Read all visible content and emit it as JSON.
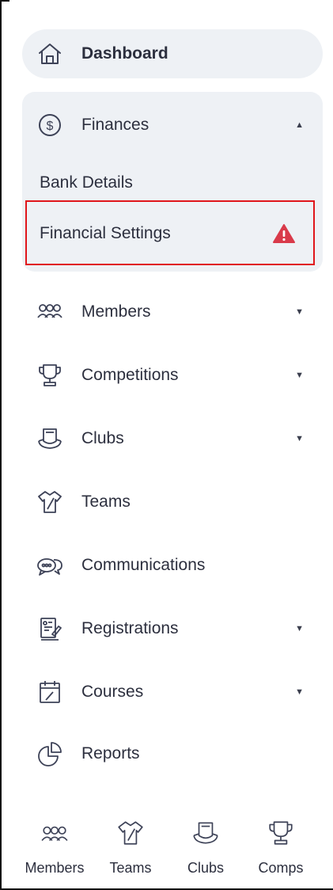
{
  "nav": {
    "dashboard": {
      "label": "Dashboard",
      "icon": "home-icon"
    },
    "finances": {
      "label": "Finances",
      "icon": "dollar-circle-icon",
      "expanded": true,
      "sub_items": [
        {
          "label": "Bank Details"
        },
        {
          "label": "Financial Settings",
          "warning_icon": "warning-triangle-icon",
          "warning_color": "#d93a4a"
        }
      ]
    },
    "members": {
      "label": "Members",
      "icon": "members-icon"
    },
    "competitions": {
      "label": "Competitions",
      "icon": "trophy-icon"
    },
    "clubs": {
      "label": "Clubs",
      "icon": "club-shield-icon"
    },
    "teams": {
      "label": "Teams",
      "icon": "jersey-icon"
    },
    "communications": {
      "label": "Communications",
      "icon": "chat-bubbles-icon"
    },
    "registrations": {
      "label": "Registrations",
      "icon": "clipboard-icon"
    },
    "courses": {
      "label": "Courses",
      "icon": "calendar-icon"
    },
    "reports": {
      "label": "Reports",
      "icon": "pie-chart-icon"
    }
  },
  "bottom_nav": [
    {
      "label": "Members",
      "icon": "members-icon"
    },
    {
      "label": "Teams",
      "icon": "jersey-icon"
    },
    {
      "label": "Clubs",
      "icon": "club-shield-icon"
    },
    {
      "label": "Comps",
      "icon": "trophy-icon"
    }
  ],
  "colors": {
    "highlight_border": "#e0161b",
    "pill_bg": "#eef1f5",
    "text": "#2c2f3e"
  }
}
